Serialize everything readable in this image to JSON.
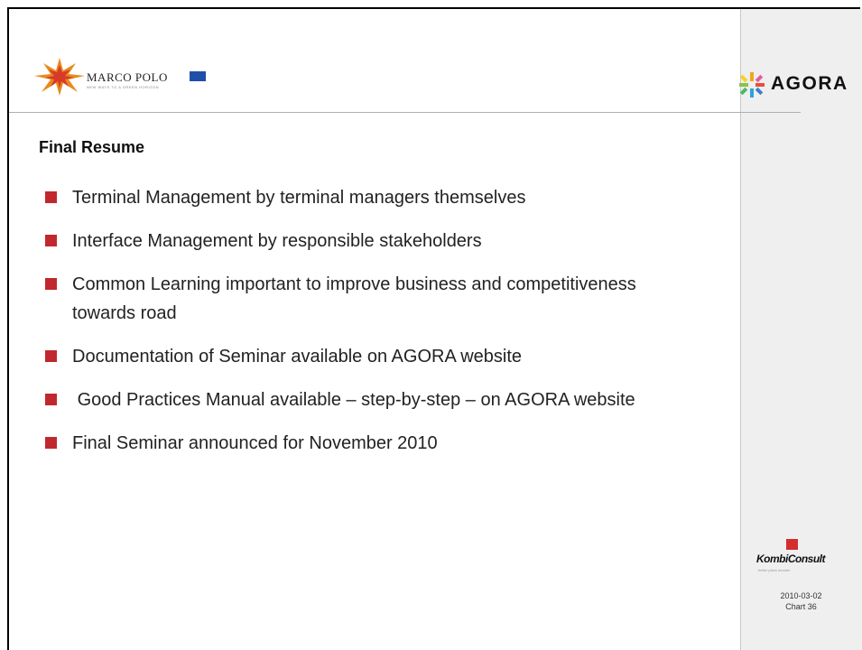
{
  "header": {
    "left_logo_text": "MARCO POLO",
    "left_logo_subtext": "NEW WAYS TO A GREEN HORIZON",
    "right_logo_text": "AGORA"
  },
  "slide": {
    "title": "Final Resume",
    "bullets": [
      "Terminal Management by terminal managers themselves",
      "Interface Management by responsible stakeholders",
      "Common Learning important to improve business and competitiveness towards road",
      "Documentation of Seminar available on AGORA website",
      " Good Practices Manual available – step-by-step – on AGORA website",
      "Final Seminar announced for November 2010"
    ]
  },
  "footer": {
    "logo_text": "KombiConsult",
    "logo_subtext": "better plans smarter",
    "date": "2010-03-02",
    "chart_label": "Chart 36"
  },
  "colors": {
    "bullet": "#c0282d",
    "sidebar": "#efefef"
  }
}
